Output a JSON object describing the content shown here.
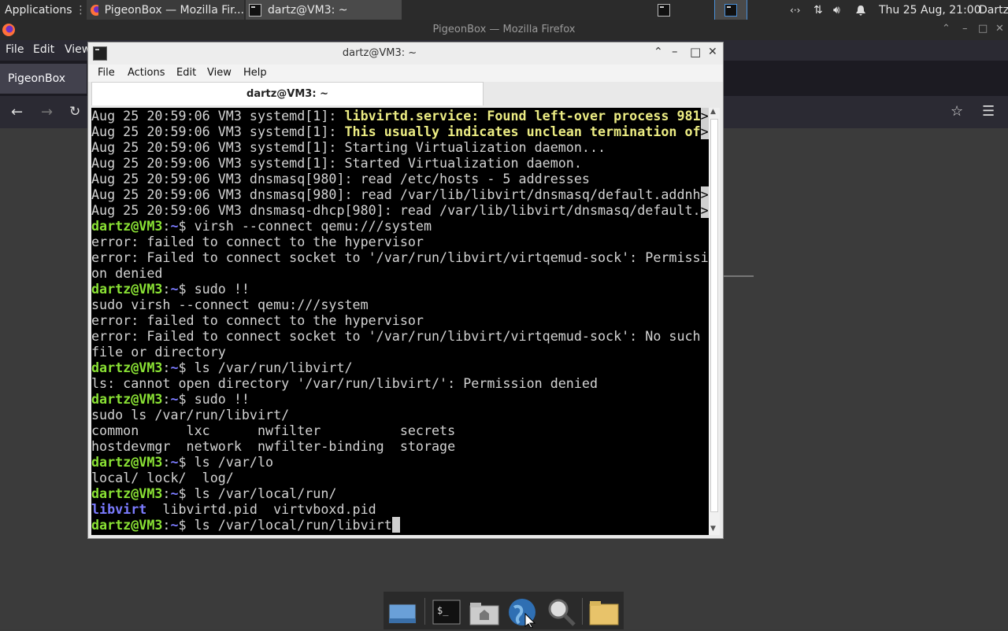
{
  "top_panel": {
    "applications_label": "Applications",
    "tasks": [
      {
        "label": "PigeonBox — Mozilla Fir..."
      },
      {
        "label": "dartz@VM3: ~"
      }
    ],
    "clock": "Thu 25 Aug, 21:00",
    "user": "Dartz"
  },
  "firefox": {
    "window_title": "PigeonBox — Mozilla Firefox",
    "menu": [
      "File",
      "Edit",
      "View"
    ],
    "tab_label": "PigeonBox"
  },
  "terminal": {
    "window_title": "dartz@VM3: ~",
    "menu": [
      "File",
      "Actions",
      "Edit",
      "View",
      "Help"
    ],
    "tab_label": "dartz@VM3: ~",
    "lines": [
      [
        {
          "t": "Aug 25 20:59:06 VM3 systemd[1]: "
        },
        {
          "t": "libvirtd.service: Found left-over process 981",
          "c": "y"
        },
        {
          "t": ">",
          "c": "arrow"
        }
      ],
      [
        {
          "t": "Aug 25 20:59:06 VM3 systemd[1]: "
        },
        {
          "t": "This usually indicates unclean termination of",
          "c": "y"
        },
        {
          "t": ">",
          "c": "arrow"
        }
      ],
      [
        {
          "t": "Aug 25 20:59:06 VM3 systemd[1]: Starting Virtualization daemon..."
        }
      ],
      [
        {
          "t": "Aug 25 20:59:06 VM3 systemd[1]: Started Virtualization daemon."
        }
      ],
      [
        {
          "t": "Aug 25 20:59:06 VM3 dnsmasq[980]: read /etc/hosts - 5 addresses"
        }
      ],
      [
        {
          "t": "Aug 25 20:59:06 VM3 dnsmasq[980]: read /var/lib/libvirt/dnsmasq/default.addnh"
        },
        {
          "t": ">",
          "c": "arrow"
        }
      ],
      [
        {
          "t": "Aug 25 20:59:06 VM3 dnsmasq-dhcp[980]: read /var/lib/libvirt/dnsmasq/default."
        },
        {
          "t": ">",
          "c": "arrow"
        }
      ],
      [
        {
          "t": "dartz@VM3",
          "c": "g"
        },
        {
          "t": ":"
        },
        {
          "t": "~",
          "c": "b"
        },
        {
          "t": "$ virsh --connect qemu:///system"
        }
      ],
      [
        {
          "t": "error: failed to connect to the hypervisor"
        }
      ],
      [
        {
          "t": "error: Failed to connect socket to '/var/run/libvirt/virtqemud-sock': Permissi"
        }
      ],
      [
        {
          "t": "on denied"
        }
      ],
      [
        {
          "t": "dartz@VM3",
          "c": "g"
        },
        {
          "t": ":"
        },
        {
          "t": "~",
          "c": "b"
        },
        {
          "t": "$ sudo !!"
        }
      ],
      [
        {
          "t": "sudo virsh --connect qemu:///system"
        }
      ],
      [
        {
          "t": "error: failed to connect to the hypervisor"
        }
      ],
      [
        {
          "t": "error: Failed to connect socket to '/var/run/libvirt/virtqemud-sock': No such"
        }
      ],
      [
        {
          "t": "file or directory"
        }
      ],
      [
        {
          "t": "dartz@VM3",
          "c": "g"
        },
        {
          "t": ":"
        },
        {
          "t": "~",
          "c": "b"
        },
        {
          "t": "$ ls /var/run/libvirt/"
        }
      ],
      [
        {
          "t": "ls: cannot open directory '/var/run/libvirt/': Permission denied"
        }
      ],
      [
        {
          "t": "dartz@VM3",
          "c": "g"
        },
        {
          "t": ":"
        },
        {
          "t": "~",
          "c": "b"
        },
        {
          "t": "$ sudo !!"
        }
      ],
      [
        {
          "t": "sudo ls /var/run/libvirt/"
        }
      ],
      [
        {
          "t": "common      lxc      nwfilter          secrets"
        }
      ],
      [
        {
          "t": "hostdevmgr  network  nwfilter-binding  storage"
        }
      ],
      [
        {
          "t": "dartz@VM3",
          "c": "g"
        },
        {
          "t": ":"
        },
        {
          "t": "~",
          "c": "b"
        },
        {
          "t": "$ ls /var/lo"
        }
      ],
      [
        {
          "t": "local/ lock/  log/"
        }
      ],
      [
        {
          "t": "dartz@VM3",
          "c": "g"
        },
        {
          "t": ":"
        },
        {
          "t": "~",
          "c": "b"
        },
        {
          "t": "$ ls /var/local/run/"
        }
      ],
      [
        {
          "t": "libvirt",
          "c": "b"
        },
        {
          "t": "  libvirtd.pid  virtvboxd.pid"
        }
      ],
      [
        {
          "t": "dartz@VM3",
          "c": "g"
        },
        {
          "t": ":"
        },
        {
          "t": "~",
          "c": "b"
        },
        {
          "t": "$ ls /var/local/run/libvirt"
        },
        {
          "t": " ",
          "c": "cursor"
        }
      ]
    ]
  },
  "dock": {
    "items": [
      "show-desktop",
      "terminal",
      "home-folder",
      "web-browser",
      "app-finder",
      "files"
    ]
  }
}
